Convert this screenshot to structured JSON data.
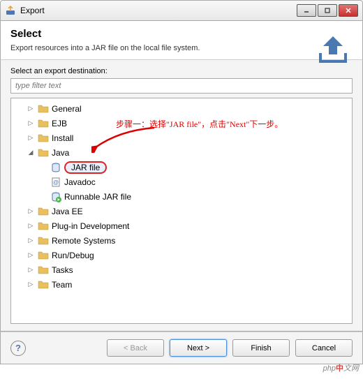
{
  "window": {
    "title": "Export"
  },
  "header": {
    "title": "Select",
    "desc": "Export resources into a JAR file on the local file system."
  },
  "body": {
    "dest_label": "Select an export destination:",
    "filter_placeholder": "type filter text"
  },
  "tree": {
    "items": [
      {
        "label": "General",
        "type": "folder",
        "expanded": false,
        "depth": 1
      },
      {
        "label": "EJB",
        "type": "folder",
        "expanded": false,
        "depth": 1
      },
      {
        "label": "Install",
        "type": "folder",
        "expanded": false,
        "depth": 1
      },
      {
        "label": "Java",
        "type": "folder",
        "expanded": true,
        "depth": 1
      },
      {
        "label": "JAR file",
        "type": "jar",
        "depth": 2,
        "selected": true
      },
      {
        "label": "Javadoc",
        "type": "javadoc",
        "depth": 2
      },
      {
        "label": "Runnable JAR file",
        "type": "runjar",
        "depth": 2
      },
      {
        "label": "Java EE",
        "type": "folder",
        "expanded": false,
        "depth": 1
      },
      {
        "label": "Plug-in Development",
        "type": "folder",
        "expanded": false,
        "depth": 1
      },
      {
        "label": "Remote Systems",
        "type": "folder",
        "expanded": false,
        "depth": 1
      },
      {
        "label": "Run/Debug",
        "type": "folder",
        "expanded": false,
        "depth": 1
      },
      {
        "label": "Tasks",
        "type": "folder",
        "expanded": false,
        "depth": 1
      },
      {
        "label": "Team",
        "type": "folder",
        "expanded": false,
        "depth": 1
      }
    ]
  },
  "annotation": {
    "text": "步骤一：选择\"JAR file\"，点击\"Next\"下一步。"
  },
  "footer": {
    "back": "< Back",
    "next": "Next >",
    "finish": "Finish",
    "cancel": "Cancel"
  },
  "watermark": {
    "pre": "php",
    "mid": "中",
    "post": "文网"
  }
}
